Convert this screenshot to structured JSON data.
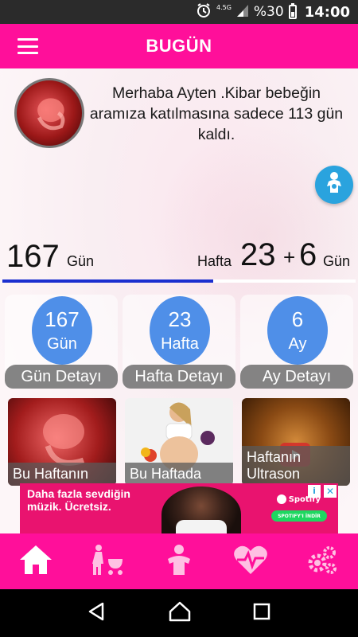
{
  "status_bar": {
    "network": "4.5G",
    "battery": "%30",
    "time": "14:00"
  },
  "app_bar": {
    "title": "BUGÜN"
  },
  "greeting": {
    "text": "Merhaba Ayten .Kibar bebeğin aramıza katılmasına sadece 113 gün kaldı."
  },
  "progress": {
    "days": "167",
    "days_unit": "Gün",
    "week_label": "Hafta",
    "weeks": "23",
    "plus": "+",
    "extra_days": "6",
    "extra_days_unit": "Gün",
    "fraction_complete": 0.596
  },
  "stats": [
    {
      "value": "167",
      "unit": "Gün",
      "label": "Gün Detayı"
    },
    {
      "value": "23",
      "unit": "Hafta",
      "label": "Hafta Detayı"
    },
    {
      "value": "6",
      "unit": "Ay",
      "label": "Ay Detayı"
    }
  ],
  "tiles": [
    {
      "caption": "Bu Haftanın"
    },
    {
      "caption": "Bu Haftada"
    },
    {
      "caption": "Haftanın Ultrason"
    }
  ],
  "ad": {
    "text": "Daha fazla sevdiğin müzik. Ücretsiz.",
    "brand": "Spotify",
    "cta": "SPOTIFY'I İNDİR",
    "info": "i",
    "close": "✕"
  },
  "bottom_nav": [
    {
      "icon": "home-icon",
      "active": true
    },
    {
      "icon": "mother-stroller-icon",
      "active": false
    },
    {
      "icon": "baby-icon",
      "active": false
    },
    {
      "icon": "heart-rate-icon",
      "active": false
    },
    {
      "icon": "settings-gears-icon",
      "active": false
    }
  ],
  "colors": {
    "primary": "#ff0f9a",
    "progress": "#1b2fcf",
    "stat_circle": "#4f8fe8",
    "fab": "#2aa3de"
  }
}
